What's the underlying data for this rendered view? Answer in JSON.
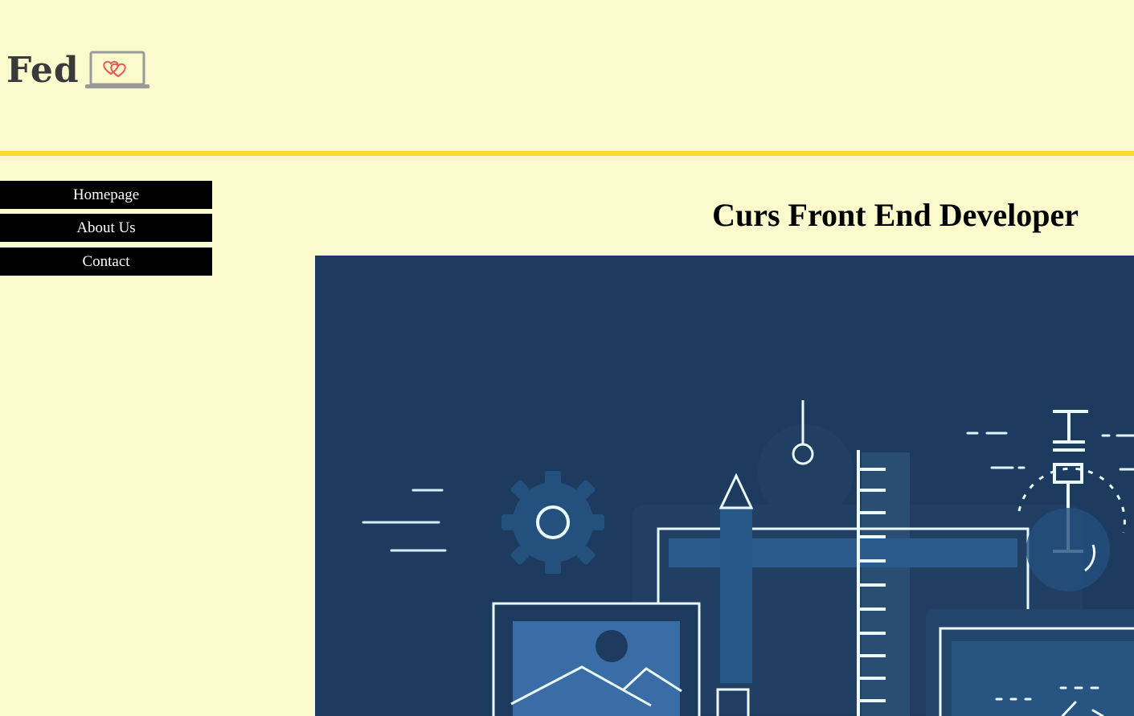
{
  "logo": {
    "text": "Fed",
    "icon": "laptop-hearts-icon"
  },
  "colors": {
    "background": "#fafacd",
    "accent": "#ffd92e",
    "nav_bg": "#000000",
    "nav_text": "#ffffff",
    "hero_bg": "#1c3b5e",
    "hero_line": "#dff4ff"
  },
  "nav": {
    "items": [
      {
        "label": "Homepage"
      },
      {
        "label": "About Us"
      },
      {
        "label": "Contact"
      }
    ]
  },
  "main": {
    "title": "Curs Front End Developer",
    "hero_image": "front-end-development-illustration"
  }
}
